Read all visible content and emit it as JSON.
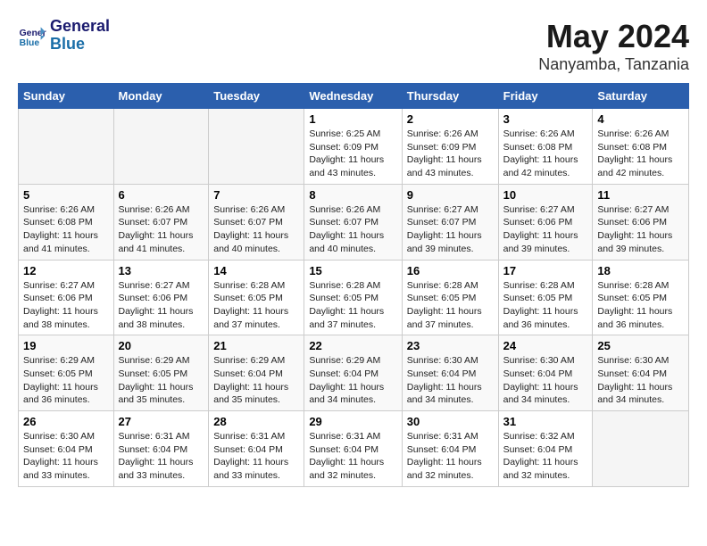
{
  "header": {
    "logo": {
      "line1": "General",
      "line2": "Blue"
    },
    "title": "May 2024",
    "subtitle": "Nanyamba, Tanzania"
  },
  "days_of_week": [
    "Sunday",
    "Monday",
    "Tuesday",
    "Wednesday",
    "Thursday",
    "Friday",
    "Saturday"
  ],
  "weeks": [
    [
      {
        "day": "",
        "info": ""
      },
      {
        "day": "",
        "info": ""
      },
      {
        "day": "",
        "info": ""
      },
      {
        "day": "1",
        "info": "Sunrise: 6:25 AM\nSunset: 6:09 PM\nDaylight: 11 hours and 43 minutes."
      },
      {
        "day": "2",
        "info": "Sunrise: 6:26 AM\nSunset: 6:09 PM\nDaylight: 11 hours and 43 minutes."
      },
      {
        "day": "3",
        "info": "Sunrise: 6:26 AM\nSunset: 6:08 PM\nDaylight: 11 hours and 42 minutes."
      },
      {
        "day": "4",
        "info": "Sunrise: 6:26 AM\nSunset: 6:08 PM\nDaylight: 11 hours and 42 minutes."
      }
    ],
    [
      {
        "day": "5",
        "info": "Sunrise: 6:26 AM\nSunset: 6:08 PM\nDaylight: 11 hours and 41 minutes."
      },
      {
        "day": "6",
        "info": "Sunrise: 6:26 AM\nSunset: 6:07 PM\nDaylight: 11 hours and 41 minutes."
      },
      {
        "day": "7",
        "info": "Sunrise: 6:26 AM\nSunset: 6:07 PM\nDaylight: 11 hours and 40 minutes."
      },
      {
        "day": "8",
        "info": "Sunrise: 6:26 AM\nSunset: 6:07 PM\nDaylight: 11 hours and 40 minutes."
      },
      {
        "day": "9",
        "info": "Sunrise: 6:27 AM\nSunset: 6:07 PM\nDaylight: 11 hours and 39 minutes."
      },
      {
        "day": "10",
        "info": "Sunrise: 6:27 AM\nSunset: 6:06 PM\nDaylight: 11 hours and 39 minutes."
      },
      {
        "day": "11",
        "info": "Sunrise: 6:27 AM\nSunset: 6:06 PM\nDaylight: 11 hours and 39 minutes."
      }
    ],
    [
      {
        "day": "12",
        "info": "Sunrise: 6:27 AM\nSunset: 6:06 PM\nDaylight: 11 hours and 38 minutes."
      },
      {
        "day": "13",
        "info": "Sunrise: 6:27 AM\nSunset: 6:06 PM\nDaylight: 11 hours and 38 minutes."
      },
      {
        "day": "14",
        "info": "Sunrise: 6:28 AM\nSunset: 6:05 PM\nDaylight: 11 hours and 37 minutes."
      },
      {
        "day": "15",
        "info": "Sunrise: 6:28 AM\nSunset: 6:05 PM\nDaylight: 11 hours and 37 minutes."
      },
      {
        "day": "16",
        "info": "Sunrise: 6:28 AM\nSunset: 6:05 PM\nDaylight: 11 hours and 37 minutes."
      },
      {
        "day": "17",
        "info": "Sunrise: 6:28 AM\nSunset: 6:05 PM\nDaylight: 11 hours and 36 minutes."
      },
      {
        "day": "18",
        "info": "Sunrise: 6:28 AM\nSunset: 6:05 PM\nDaylight: 11 hours and 36 minutes."
      }
    ],
    [
      {
        "day": "19",
        "info": "Sunrise: 6:29 AM\nSunset: 6:05 PM\nDaylight: 11 hours and 36 minutes."
      },
      {
        "day": "20",
        "info": "Sunrise: 6:29 AM\nSunset: 6:05 PM\nDaylight: 11 hours and 35 minutes."
      },
      {
        "day": "21",
        "info": "Sunrise: 6:29 AM\nSunset: 6:04 PM\nDaylight: 11 hours and 35 minutes."
      },
      {
        "day": "22",
        "info": "Sunrise: 6:29 AM\nSunset: 6:04 PM\nDaylight: 11 hours and 34 minutes."
      },
      {
        "day": "23",
        "info": "Sunrise: 6:30 AM\nSunset: 6:04 PM\nDaylight: 11 hours and 34 minutes."
      },
      {
        "day": "24",
        "info": "Sunrise: 6:30 AM\nSunset: 6:04 PM\nDaylight: 11 hours and 34 minutes."
      },
      {
        "day": "25",
        "info": "Sunrise: 6:30 AM\nSunset: 6:04 PM\nDaylight: 11 hours and 34 minutes."
      }
    ],
    [
      {
        "day": "26",
        "info": "Sunrise: 6:30 AM\nSunset: 6:04 PM\nDaylight: 11 hours and 33 minutes."
      },
      {
        "day": "27",
        "info": "Sunrise: 6:31 AM\nSunset: 6:04 PM\nDaylight: 11 hours and 33 minutes."
      },
      {
        "day": "28",
        "info": "Sunrise: 6:31 AM\nSunset: 6:04 PM\nDaylight: 11 hours and 33 minutes."
      },
      {
        "day": "29",
        "info": "Sunrise: 6:31 AM\nSunset: 6:04 PM\nDaylight: 11 hours and 32 minutes."
      },
      {
        "day": "30",
        "info": "Sunrise: 6:31 AM\nSunset: 6:04 PM\nDaylight: 11 hours and 32 minutes."
      },
      {
        "day": "31",
        "info": "Sunrise: 6:32 AM\nSunset: 6:04 PM\nDaylight: 11 hours and 32 minutes."
      },
      {
        "day": "",
        "info": ""
      }
    ]
  ]
}
